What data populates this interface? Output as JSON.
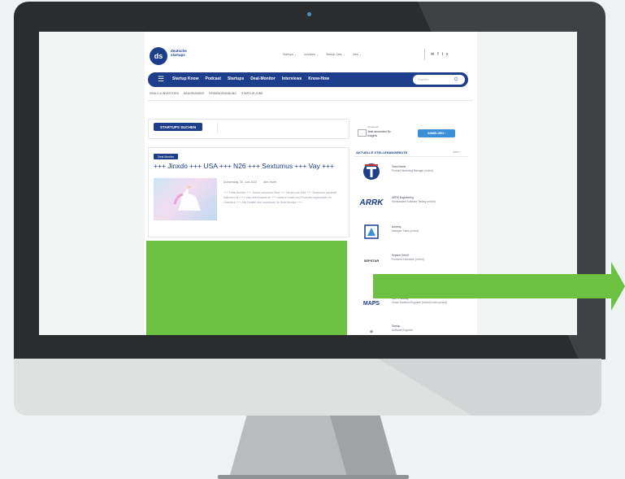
{
  "site": {
    "logo_initials": "ds",
    "logo_name_line1": "deutsche",
    "logo_name_line2": "startups",
    "top_links": [
      "Startups ⌄",
      "Investors ⌄",
      "Startup Jobs ⌄",
      "Jobs ⌄"
    ],
    "social_icons": [
      "mail-icon",
      "facebook-icon",
      "twitter-icon",
      "xing-icon"
    ],
    "social_glyphs": [
      "✉",
      "f",
      "t",
      "x"
    ],
    "nav": {
      "menu_glyph": "☰",
      "items": [
        "Startup Know",
        "Podcast",
        "Startups",
        "Deal-Monitor",
        "Interviews",
        "Know-How"
      ],
      "search_placeholder": "Suchen",
      "search_glyph": "○"
    },
    "subnav": [
      "DEALS & INVESTORS",
      "NEUGRÜNDER",
      "FIRMENGRÜNDUNG",
      "STARTUP-JOBS"
    ]
  },
  "main": {
    "startup_button": "STARTUPS SUCHEN",
    "article": {
      "badge": "Deal-Monitor",
      "title": "+++ Jinxdo +++ USA +++ N26 +++ Sextumus +++ Vay +++",
      "date": "Donnerstag, 30. Juni 2022",
      "comments": "Alex Hofer",
      "excerpt": "+++ Deal-Monitor +++ Jinxdo bekommt Geld +++ Neues von N26 +++ Sextumus sammelt Millionen ein +++ Vay zieht Kapital an +++ weitere Deals und Finanzierungsrunden im Überblick +++ Alle Details und Investoren im Deal-Monitor +++"
    }
  },
  "sidebar": {
    "newsletter": {
      "label_small": "Newsletter",
      "label": "Jetzt anmelden für Insights",
      "button": "ANMELDEN ›"
    },
    "jobs_header": "AKTUELLE STELLENANGEBOTE",
    "jobs_more": "mehr ›",
    "jobs": [
      {
        "logo": "T",
        "company": "TeamViewer",
        "title": "Product Marketing Manager (m/w/d)"
      },
      {
        "logo": "ARRK",
        "company": "ARRK Engineering",
        "title": "Werkstudent Software Testing (m/w/d)"
      },
      {
        "logo": "A",
        "company": "Adverity",
        "title": "Manager Sales (m/w/d)"
      },
      {
        "logo": "SEPSTAR",
        "company": "Sepstar GmbH",
        "title": "Frontend Entwickler (m/w/d)"
      },
      {
        "logo": "MAPS",
        "company": "MAPS Mobility",
        "title": "Senior Backend Engineer (m/w/d) Kotlin (m/w/d)"
      },
      {
        "logo": "●",
        "company": "Startup",
        "title": "Software Engineer"
      }
    ]
  },
  "colors": {
    "brand": "#1d3e8a",
    "accent_green": "#6dc142",
    "button_blue": "#3a8fd6"
  }
}
